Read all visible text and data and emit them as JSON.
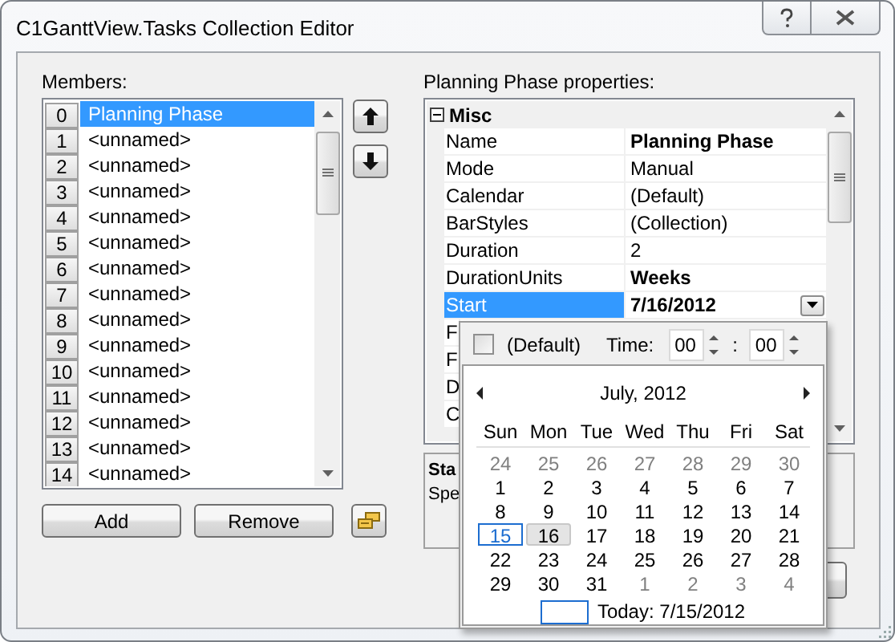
{
  "window": {
    "title": "C1GanttView.Tasks Collection Editor"
  },
  "members": {
    "label": "Members:",
    "items": [
      {
        "index": "0",
        "name": "Planning Phase",
        "selected": true
      },
      {
        "index": "1",
        "name": "<unnamed>",
        "selected": false
      },
      {
        "index": "2",
        "name": "<unnamed>",
        "selected": false
      },
      {
        "index": "3",
        "name": "<unnamed>",
        "selected": false
      },
      {
        "index": "4",
        "name": "<unnamed>",
        "selected": false
      },
      {
        "index": "5",
        "name": "<unnamed>",
        "selected": false
      },
      {
        "index": "6",
        "name": "<unnamed>",
        "selected": false
      },
      {
        "index": "7",
        "name": "<unnamed>",
        "selected": false
      },
      {
        "index": "8",
        "name": "<unnamed>",
        "selected": false
      },
      {
        "index": "9",
        "name": "<unnamed>",
        "selected": false
      },
      {
        "index": "10",
        "name": "<unnamed>",
        "selected": false
      },
      {
        "index": "11",
        "name": "<unnamed>",
        "selected": false
      },
      {
        "index": "12",
        "name": "<unnamed>",
        "selected": false
      },
      {
        "index": "13",
        "name": "<unnamed>",
        "selected": false
      },
      {
        "index": "14",
        "name": "<unnamed>",
        "selected": false
      }
    ]
  },
  "member_buttons": [
    "Add",
    "Remove"
  ],
  "properties": {
    "label": "Planning Phase properties:",
    "category": {
      "name": "Misc",
      "expanded": true
    },
    "rows": [
      {
        "name": "Name",
        "value": "Planning Phase",
        "bold": true,
        "selected": false
      },
      {
        "name": "Mode",
        "value": "Manual",
        "bold": false,
        "selected": false
      },
      {
        "name": "Calendar",
        "value": "(Default)",
        "bold": false,
        "selected": false
      },
      {
        "name": "BarStyles",
        "value": "(Collection)",
        "bold": false,
        "selected": false
      },
      {
        "name": "Duration",
        "value": "2",
        "bold": false,
        "selected": false
      },
      {
        "name": "DurationUnits",
        "value": "Weeks",
        "bold": true,
        "selected": false
      },
      {
        "name": "Start",
        "value": "7/16/2012",
        "bold": true,
        "selected": true
      },
      {
        "name": "F"
      },
      {
        "name": "F"
      },
      {
        "name": "D"
      },
      {
        "name": "C"
      }
    ]
  },
  "description": {
    "title": "Sta",
    "text": "Spe"
  },
  "date_popup": {
    "default_label": "(Default)",
    "default_checked": false,
    "time_label": "Time:",
    "hour": "00",
    "separator": ":",
    "minute": "00",
    "month_label": "July, 2012",
    "weekdays": [
      "Sun",
      "Mon",
      "Tue",
      "Wed",
      "Thu",
      "Fri",
      "Sat"
    ],
    "days": [
      {
        "label": "24",
        "other_month": true,
        "selected": false,
        "today": false
      },
      {
        "label": "25",
        "other_month": true,
        "selected": false,
        "today": false
      },
      {
        "label": "26",
        "other_month": true,
        "selected": false,
        "today": false
      },
      {
        "label": "27",
        "other_month": true,
        "selected": false,
        "today": false
      },
      {
        "label": "28",
        "other_month": true,
        "selected": false,
        "today": false
      },
      {
        "label": "29",
        "other_month": true,
        "selected": false,
        "today": false
      },
      {
        "label": "30",
        "other_month": true,
        "selected": false,
        "today": false
      },
      {
        "label": "1",
        "other_month": false,
        "selected": false,
        "today": false
      },
      {
        "label": "2",
        "other_month": false,
        "selected": false,
        "today": false
      },
      {
        "label": "3",
        "other_month": false,
        "selected": false,
        "today": false
      },
      {
        "label": "4",
        "other_month": false,
        "selected": false,
        "today": false
      },
      {
        "label": "5",
        "other_month": false,
        "selected": false,
        "today": false
      },
      {
        "label": "6",
        "other_month": false,
        "selected": false,
        "today": false
      },
      {
        "label": "7",
        "other_month": false,
        "selected": false,
        "today": false
      },
      {
        "label": "8",
        "other_month": false,
        "selected": false,
        "today": false
      },
      {
        "label": "9",
        "other_month": false,
        "selected": false,
        "today": false
      },
      {
        "label": "10",
        "other_month": false,
        "selected": false,
        "today": false
      },
      {
        "label": "11",
        "other_month": false,
        "selected": false,
        "today": false
      },
      {
        "label": "12",
        "other_month": false,
        "selected": false,
        "today": false
      },
      {
        "label": "13",
        "other_month": false,
        "selected": false,
        "today": false
      },
      {
        "label": "14",
        "other_month": false,
        "selected": false,
        "today": false
      },
      {
        "label": "15",
        "other_month": false,
        "selected": false,
        "today": true
      },
      {
        "label": "16",
        "other_month": false,
        "selected": true,
        "today": false
      },
      {
        "label": "17",
        "other_month": false,
        "selected": false,
        "today": false
      },
      {
        "label": "18",
        "other_month": false,
        "selected": false,
        "today": false
      },
      {
        "label": "19",
        "other_month": false,
        "selected": false,
        "today": false
      },
      {
        "label": "20",
        "other_month": false,
        "selected": false,
        "today": false
      },
      {
        "label": "21",
        "other_month": false,
        "selected": false,
        "today": false
      },
      {
        "label": "22",
        "other_month": false,
        "selected": false,
        "today": false
      },
      {
        "label": "23",
        "other_month": false,
        "selected": false,
        "today": false
      },
      {
        "label": "24",
        "other_month": false,
        "selected": false,
        "today": false
      },
      {
        "label": "25",
        "other_month": false,
        "selected": false,
        "today": false
      },
      {
        "label": "26",
        "other_month": false,
        "selected": false,
        "today": false
      },
      {
        "label": "27",
        "other_month": false,
        "selected": false,
        "today": false
      },
      {
        "label": "28",
        "other_month": false,
        "selected": false,
        "today": false
      },
      {
        "label": "29",
        "other_month": false,
        "selected": false,
        "today": false
      },
      {
        "label": "30",
        "other_month": false,
        "selected": false,
        "today": false
      },
      {
        "label": "31",
        "other_month": false,
        "selected": false,
        "today": false
      },
      {
        "label": "1",
        "other_month": true,
        "selected": false,
        "today": false
      },
      {
        "label": "2",
        "other_month": true,
        "selected": false,
        "today": false
      },
      {
        "label": "3",
        "other_month": true,
        "selected": false,
        "today": false
      },
      {
        "label": "4",
        "other_month": true,
        "selected": false,
        "today": false
      }
    ],
    "today_label": "Today: 7/15/2012"
  }
}
